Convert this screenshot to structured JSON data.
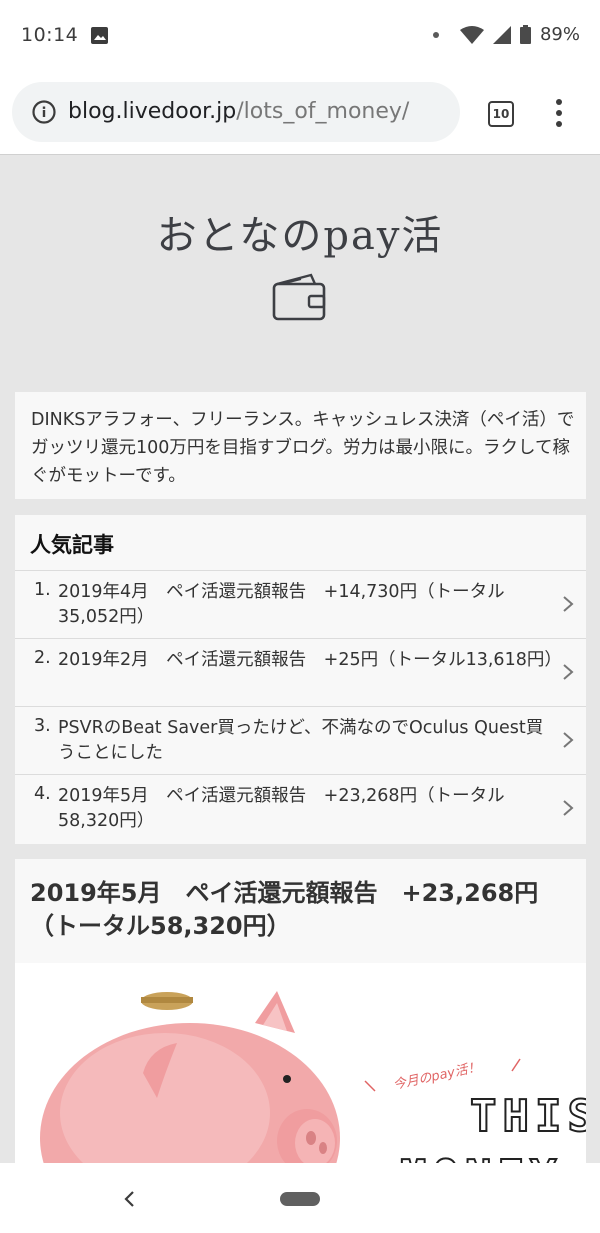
{
  "status_bar": {
    "time": "10:14",
    "battery_percent": "89%",
    "icons": [
      "image-icon",
      "notification-dot-icon",
      "wifi-icon",
      "signal-icon",
      "battery-icon"
    ]
  },
  "browser": {
    "url_domain": "blog.livedoor.jp",
    "url_path": "/lots_of_money/",
    "tab_count": "10"
  },
  "blog": {
    "title": "おとなのpay活",
    "description": "DINKSアラフォー、フリーランス。キャッシュレス決済（ペイ活）でガッツリ還元100万円を目指すブログ。労力は最小限に。ラクして稼ぐがモットーです。"
  },
  "popular": {
    "heading": "人気記事",
    "items": [
      {
        "num": "1.",
        "title": "2019年4月　ペイ活還元額報告　+14,730円（トータル35,052円）"
      },
      {
        "num": "2.",
        "title": "2019年2月　ペイ活還元額報告　+25円（トータル13,618円）"
      },
      {
        "num": "3.",
        "title": "PSVRのBeat Saver買ったけど、不満なのでOculus Quest買うことにした"
      },
      {
        "num": "4.",
        "title": "2019年5月　ペイ活還元額報告　+23,268円（トータル58,320円）"
      }
    ]
  },
  "article": {
    "title": "2019年5月　ペイ活還元額報告　+23,268円（トータル58,320円）",
    "hero_caption": "今月のpay活！",
    "hero_word1": "THIS",
    "hero_word2": "MONEY"
  },
  "colors": {
    "page_bg": "#e6e6e6",
    "card_bg": "#f8f8f8",
    "pig_pink": "#f2a9aa",
    "caption_red": "#e06464"
  }
}
